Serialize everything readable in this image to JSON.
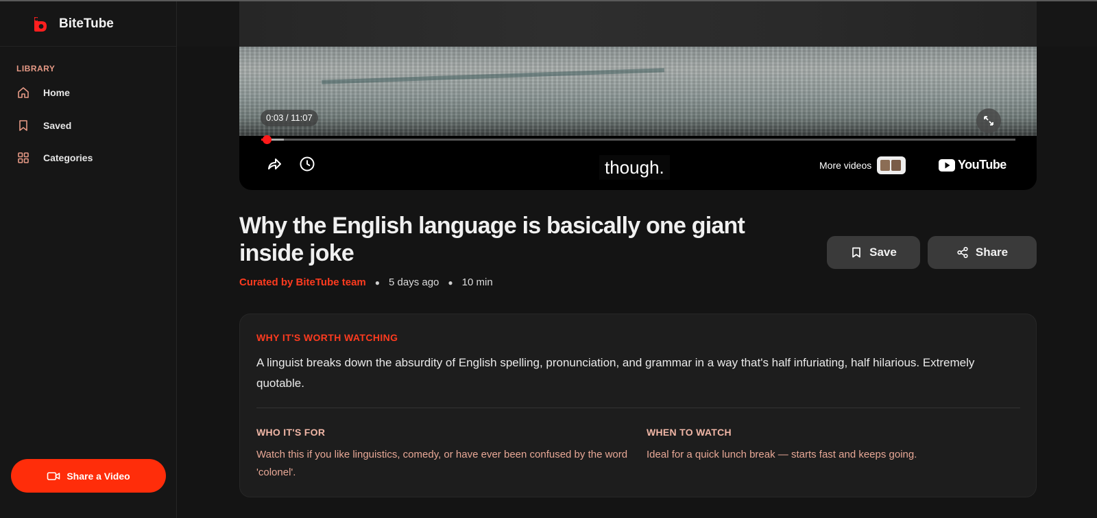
{
  "app": {
    "name": "BiteTube"
  },
  "sidebar": {
    "section_title": "LIBRARY",
    "items": [
      {
        "label": "Home",
        "icon": "home-icon"
      },
      {
        "label": "Saved",
        "icon": "bookmark-icon"
      },
      {
        "label": "Categories",
        "icon": "grid-icon"
      }
    ],
    "share_button": "Share a Video"
  },
  "player": {
    "time": "0:03 / 11:07",
    "progress": 0.003,
    "buffered": 0.03,
    "caption": "though.",
    "more_videos": "More videos",
    "youtube": "YouTube"
  },
  "video": {
    "title": "Why the English language is basically one giant inside joke",
    "curator": "Curated by BiteTube team",
    "age": "5 days ago",
    "duration": "10 min",
    "save_label": "Save",
    "share_label": "Share"
  },
  "details": {
    "why_title": "WHY IT'S WORTH WATCHING",
    "why_text": "A linguist breaks down the absurdity of English spelling, pronunciation, and grammar in a way that's half infuriating, half hilarious. Extremely quotable.",
    "who_title": "WHO IT'S FOR",
    "who_text": "Watch this if you like linguistics, comedy, or have ever been confused by the word 'colonel'.",
    "when_title": "WHEN TO WATCH",
    "when_text": "Ideal for a quick lunch break — starts fast and keeps going."
  },
  "colors": {
    "accent": "#ff2d0a",
    "curator": "#ff3b1f",
    "label": "#e79a86"
  }
}
